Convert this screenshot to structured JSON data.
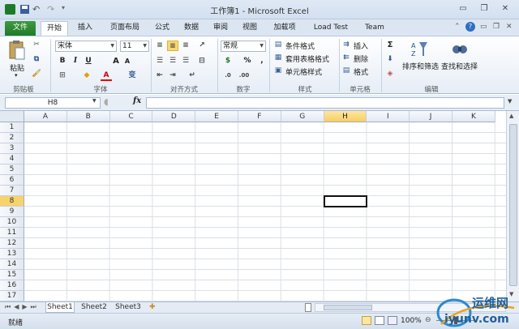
{
  "window": {
    "title": "工作簿1 - Microsoft Excel",
    "minimize": "▭",
    "restore": "❐",
    "close": "✕"
  },
  "tabs": [
    {
      "label": "文件"
    },
    {
      "label": "开始"
    },
    {
      "label": "插入"
    },
    {
      "label": "页面布局"
    },
    {
      "label": "公式"
    },
    {
      "label": "数据"
    },
    {
      "label": "审阅"
    },
    {
      "label": "视图"
    },
    {
      "label": "加载项"
    },
    {
      "label": "Load Test"
    },
    {
      "label": "Team"
    }
  ],
  "ribbon": {
    "clipboard": {
      "label": "剪贴板",
      "paste": "粘贴"
    },
    "font": {
      "label": "字体",
      "name": "宋体",
      "size": "11",
      "bold": "B",
      "italic": "I",
      "underline": "U",
      "grow": "A",
      "shrink": "A",
      "color": "A",
      "phonetic": "变"
    },
    "alignment": {
      "label": "对齐方式"
    },
    "number": {
      "label": "数字",
      "format": "常规",
      "currency": "$",
      "percent": "%",
      "comma": ","
    },
    "styles": {
      "label": "样式",
      "conditional": "条件格式",
      "table": "套用表格格式",
      "cell": "单元格样式"
    },
    "cells": {
      "label": "单元格",
      "insert": "插入",
      "delete": "删除",
      "format": "格式"
    },
    "editing": {
      "label": "编辑",
      "sum": "Σ",
      "sort": "排序和筛选",
      "find": "查找和选择"
    }
  },
  "formula_bar": {
    "name_box": "H8",
    "fx": "fx",
    "value": ""
  },
  "columns": [
    "A",
    "B",
    "C",
    "D",
    "E",
    "F",
    "G",
    "H",
    "I",
    "J",
    "K"
  ],
  "rows": [
    "1",
    "2",
    "3",
    "4",
    "5",
    "6",
    "7",
    "8",
    "9",
    "10",
    "11",
    "12",
    "13",
    "14",
    "15",
    "16",
    "17"
  ],
  "selected": {
    "col": "H",
    "row": "8"
  },
  "sheets": [
    "Sheet1",
    "Sheet2",
    "Sheet3"
  ],
  "status": {
    "ready": "就绪",
    "zoom": "100%"
  },
  "watermark": {
    "brand": "运维网",
    "url": "iyunv.com"
  }
}
